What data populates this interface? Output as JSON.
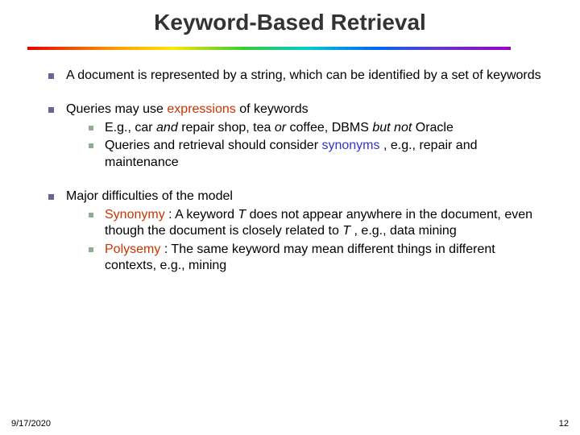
{
  "title": "Keyword-Based Retrieval",
  "bullets": [
    {
      "segments": [
        {
          "text": "A document is represented by a string, which can be identified by a set of keywords"
        }
      ]
    },
    {
      "segments": [
        {
          "text": "Queries may use "
        },
        {
          "text": "expressions"
        },
        {
          "text": " of keywords"
        }
      ],
      "sub": [
        {
          "segments": [
            {
              "text": "E.g., car "
            },
            {
              "text": "and"
            },
            {
              "text": " repair shop, tea "
            },
            {
              "text": "or"
            },
            {
              "text": " coffee, DBMS "
            },
            {
              "text": "but not"
            },
            {
              "text": " Oracle"
            }
          ]
        },
        {
          "segments": [
            {
              "text": "Queries and retrieval should consider "
            },
            {
              "text": "synonyms"
            },
            {
              "text": ", e.g., repair and maintenance"
            }
          ]
        }
      ]
    },
    {
      "segments": [
        {
          "text": "Major difficulties of the model"
        }
      ],
      "sub": [
        {
          "segments": [
            {
              "text": "Synonymy"
            },
            {
              "text": ": A keyword "
            },
            {
              "text": "T"
            },
            {
              "text": " does not appear anywhere in the document, even though the document is closely related to "
            },
            {
              "text": "T"
            },
            {
              "text": ", e.g., data mining"
            }
          ]
        },
        {
          "segments": [
            {
              "text": "Polysemy"
            },
            {
              "text": ": The same keyword may mean different things in different contexts, e.g., mining"
            }
          ]
        }
      ]
    }
  ],
  "footer": {
    "date": "9/17/2020",
    "page": "12"
  }
}
